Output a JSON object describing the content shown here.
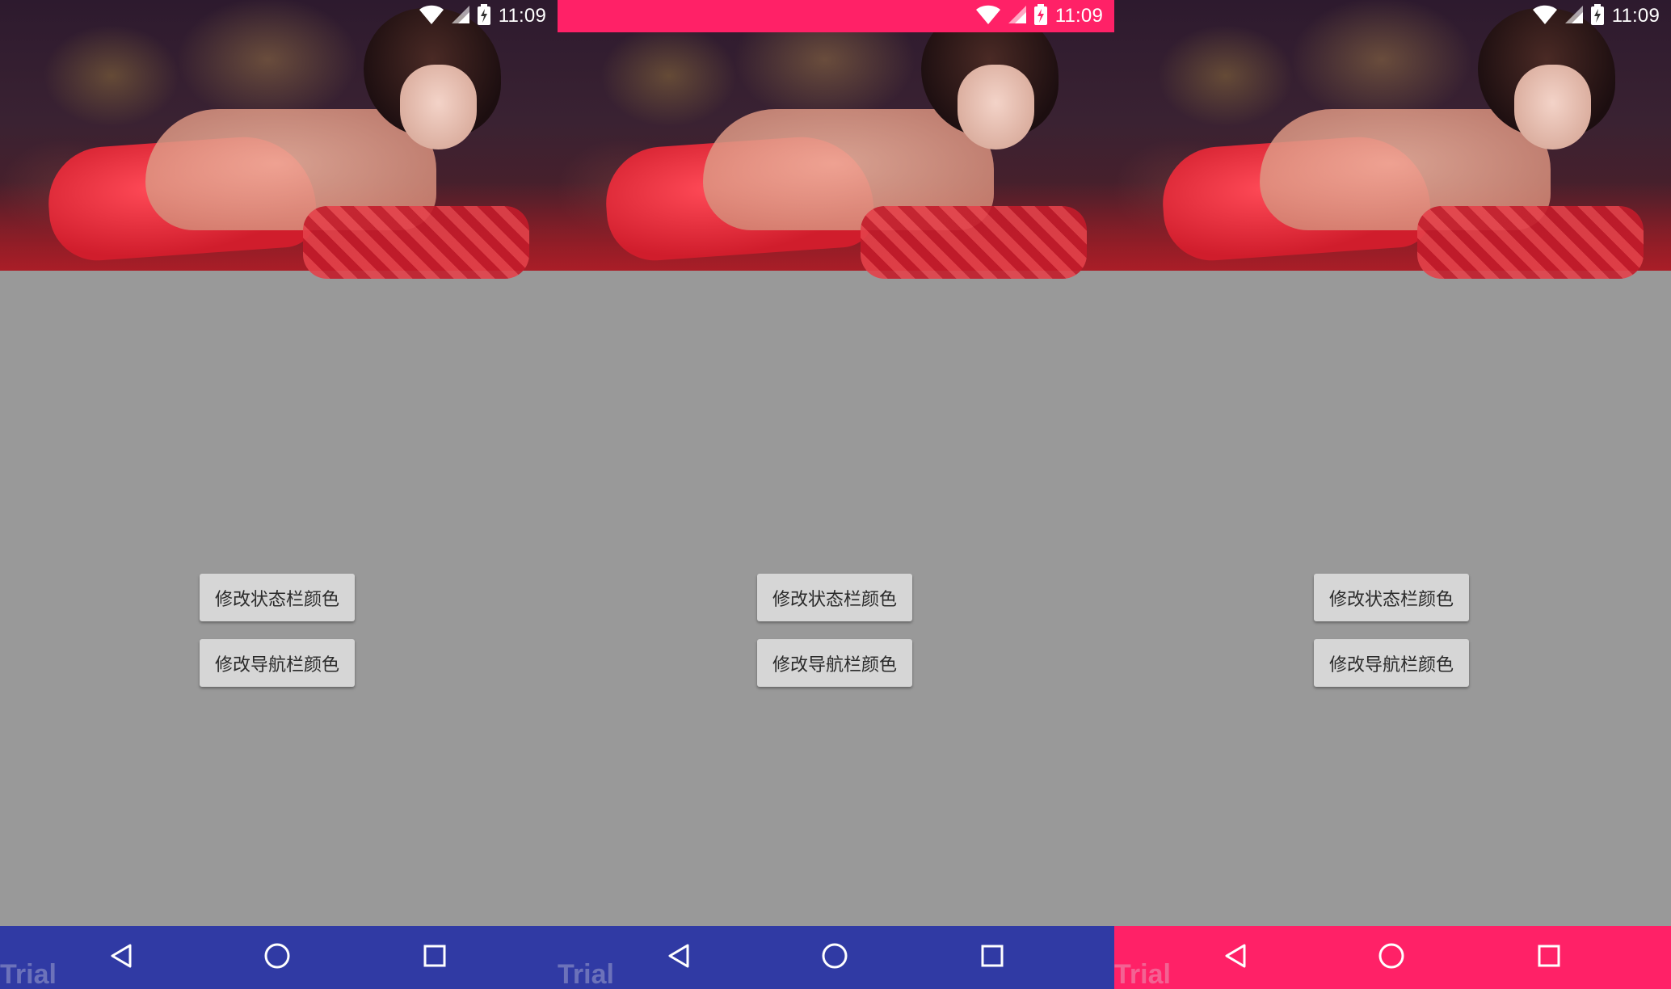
{
  "screens": [
    {
      "status": {
        "time": "11:09",
        "tinted": false
      },
      "buttons": {
        "status_bar": "修改状态栏颜色",
        "nav_bar": "修改导航栏颜色"
      },
      "navbar": {
        "watermark": "Trial",
        "color": "#303aa4"
      }
    },
    {
      "status": {
        "time": "11:09",
        "tinted": true,
        "color": "#ff2167"
      },
      "buttons": {
        "status_bar": "修改状态栏颜色",
        "nav_bar": "修改导航栏颜色"
      },
      "navbar": {
        "watermark": "Trial",
        "color": "#303aa4"
      }
    },
    {
      "status": {
        "time": "11:09",
        "tinted": false
      },
      "buttons": {
        "status_bar": "修改状态栏颜色",
        "nav_bar": "修改导航栏颜色"
      },
      "navbar": {
        "watermark": "Trial",
        "color": "#ff2167"
      }
    }
  ],
  "icons": {
    "wifi": "wifi-icon",
    "signal": "signal-icon",
    "battery": "battery-charging-icon",
    "back": "back-triangle-icon",
    "home": "home-circle-icon",
    "recents": "recents-square-icon"
  },
  "colors": {
    "background": "#999999",
    "button": "#d6d6d6",
    "accent_pink": "#ff2167",
    "nav_blue": "#303aa4"
  }
}
